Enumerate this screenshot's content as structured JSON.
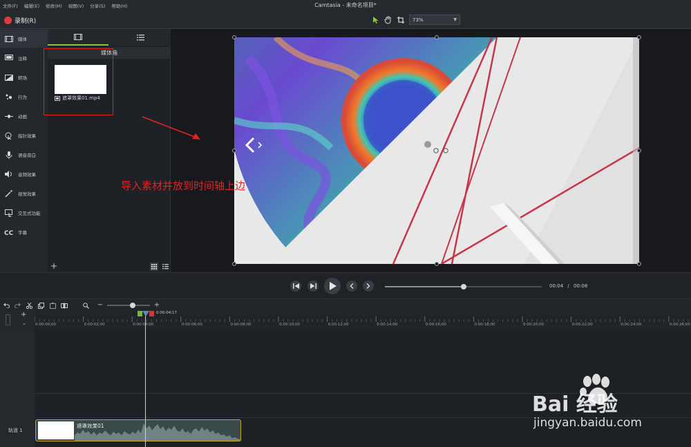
{
  "menu": [
    "文件(F)",
    "编辑(E)",
    "修改(M)",
    "视图(V)",
    "分享(S)",
    "帮助(H)"
  ],
  "app_title": "Camtasia - 未命名项目*",
  "toolbar": {
    "record_label": "录制(R)",
    "zoom_value": "73%",
    "tools": [
      "pointer-tool",
      "hand-tool",
      "crop-tool"
    ]
  },
  "sidebar": {
    "items": [
      {
        "label": "媒体",
        "icon": "film-icon"
      },
      {
        "label": "注释",
        "icon": "annotation-icon"
      },
      {
        "label": "转场",
        "icon": "transition-icon"
      },
      {
        "label": "行为",
        "icon": "behavior-icon"
      },
      {
        "label": "动画",
        "icon": "animation-icon"
      },
      {
        "label": "指针效果",
        "icon": "cursor-effect-icon"
      },
      {
        "label": "语音旁白",
        "icon": "microphone-icon"
      },
      {
        "label": "音频效果",
        "icon": "speaker-icon"
      },
      {
        "label": "视觉效果",
        "icon": "magic-wand-icon"
      },
      {
        "label": "交互式功能",
        "icon": "interactive-icon"
      },
      {
        "label": "字幕",
        "icon": "cc-icon"
      }
    ],
    "active_index": 0
  },
  "media_panel": {
    "bin_title": "媒体箱",
    "clip_name": "遮罩效果01.mp4"
  },
  "annotation": {
    "text": "导入素材并放到时间轴上边",
    "color": "#e02424"
  },
  "playback": {
    "current_time": "00:04",
    "separator": "/",
    "total_time": "00:08",
    "progress": 0.5
  },
  "timeline": {
    "playhead_time": "0:00:04;17",
    "ticks": [
      "0:00:00;00",
      "0:00:02;00",
      "0:00:04;00",
      "0:00:06;00",
      "0:00:08;00",
      "0:00:10;00",
      "0:00:12;00",
      "0:00:14;00",
      "0:00:16;00",
      "0:00:18;00",
      "0:00:20;00",
      "0:00:22;00",
      "0:00:24;00",
      "0:00:26;00"
    ],
    "track_label": "轨道 1",
    "clip_title": "遮罩效果01",
    "zoom_level": 0.6
  },
  "watermark": {
    "brand": "Bai 经验",
    "url": "jingyan.baidu.com"
  },
  "colors": {
    "accent": "#8dc63f",
    "record": "#e03a3a",
    "clip_border": "#c9a227",
    "highlight": "#e02222"
  }
}
